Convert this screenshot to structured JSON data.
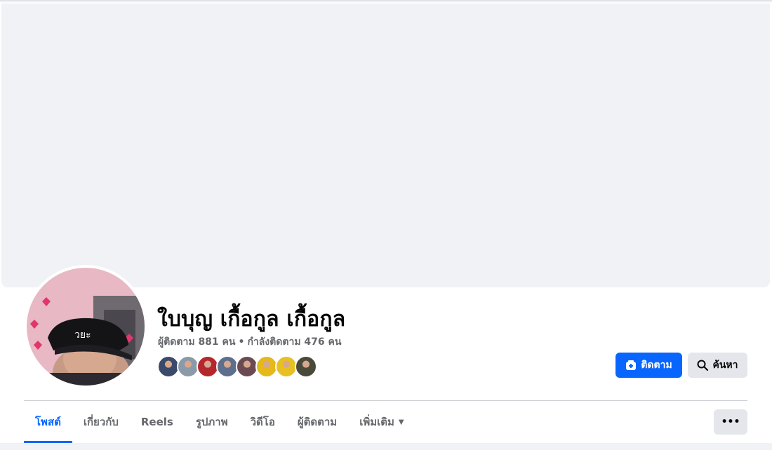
{
  "profile": {
    "name": "ใบบุญ เกื้อกูล เกื้อกูล",
    "followers": "ผู้ติดตาม 881 คน",
    "separator": "•",
    "following": "กำลังติดตาม 476 คน"
  },
  "friends": [
    {
      "icon": "friend-avatar-1",
      "color": "#3b4a6b"
    },
    {
      "icon": "friend-avatar-2",
      "color": "#8a9aa8"
    },
    {
      "icon": "friend-avatar-3",
      "color": "#b4282d"
    },
    {
      "icon": "friend-avatar-4",
      "color": "#5d6f8c"
    },
    {
      "icon": "friend-avatar-5",
      "color": "#6b4a54"
    },
    {
      "icon": "friend-avatar-6",
      "color": "#e5b91a"
    },
    {
      "icon": "friend-avatar-7",
      "color": "#e8c020"
    },
    {
      "icon": "friend-avatar-8",
      "color": "#4a4a3a"
    }
  ],
  "actions": {
    "follow_label": "ติดตาม",
    "search_label": "ค้นหา",
    "more_label": "•••"
  },
  "tabs": [
    {
      "label": "โพสต์",
      "active": true
    },
    {
      "label": "เกี่ยวกับ"
    },
    {
      "label": "Reels"
    },
    {
      "label": "รูปภาพ"
    },
    {
      "label": "วิดีโอ"
    },
    {
      "label": "ผู้ติดตาม"
    },
    {
      "label": "เพิ่มเติม"
    }
  ],
  "colors": {
    "accent": "#0866ff",
    "secondary_text": "#65676b",
    "cover_bg": "#f0f2f5"
  }
}
